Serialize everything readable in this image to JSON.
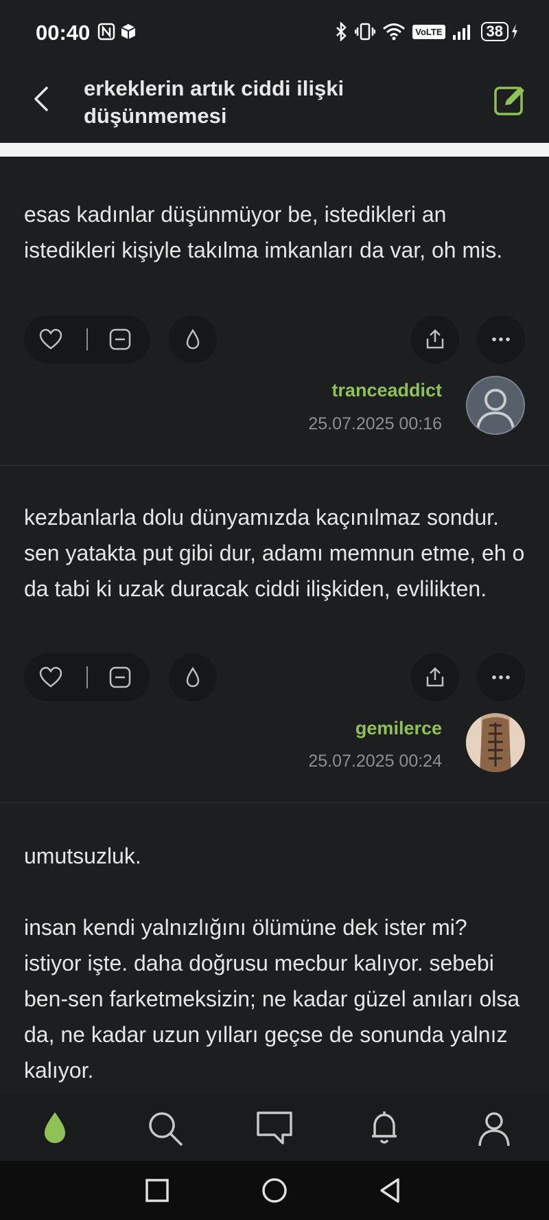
{
  "status_bar": {
    "time": "00:40",
    "volte": "VoLTE",
    "battery": "38"
  },
  "header": {
    "title": "erkeklerin artık ciddi ilişki düşünmemesi"
  },
  "entries": [
    {
      "text": "esas kadınlar düşünmüyor be, istedikleri an istedikleri kişiyle takılma imkanları da var, oh mis.",
      "author": "tranceaddict",
      "date": "25.07.2025 00:16"
    },
    {
      "text": "kezbanlarla dolu dünyamızda kaçınılmaz sondur. sen yatakta put gibi dur, adamı memnun etme, eh o da tabi ki uzak duracak ciddi ilişkiden, evlilikten.",
      "author": "gemilerce",
      "date": "25.07.2025 00:24"
    },
    {
      "text_p1": "umutsuzluk.",
      "text_p2": "insan kendi yalnızlığını ölümüne dek ister mi? istiyor işte. daha doğrusu mecbur kalıyor. sebebi ben-sen farketmeksizin; ne kadar güzel anıları olsa da, ne kadar uzun yılları geçse de sonunda yalnız kalıyor."
    }
  ],
  "icons": {
    "like": "heart-icon",
    "minus": "minus-icon",
    "drop": "drop-icon",
    "share": "share-icon",
    "more": "more-icon",
    "compose": "edit-icon"
  },
  "colors": {
    "accent": "#8fc154",
    "background": "#1d1e20"
  }
}
